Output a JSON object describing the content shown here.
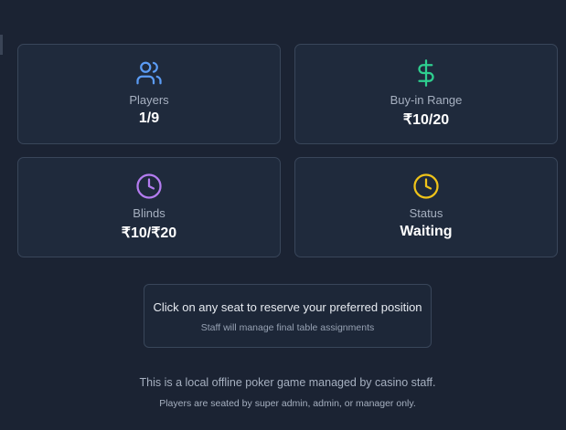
{
  "stats": {
    "players": {
      "label": "Players",
      "value": "1/9",
      "icon": "users-icon",
      "color": "#5b9cf5"
    },
    "buyin": {
      "label": "Buy-in Range",
      "value": "₹10/20",
      "icon": "dollar-icon",
      "color": "#2ecf8f"
    },
    "blinds": {
      "label": "Blinds",
      "value": "₹10/₹20",
      "icon": "clock-icon",
      "color": "#b47cf0"
    },
    "status": {
      "label": "Status",
      "value": "Waiting",
      "icon": "clock-icon",
      "color": "#f0c419"
    }
  },
  "seat_info": {
    "main": "Click on any seat to reserve your preferred position",
    "sub": "Staff will manage final table assignments"
  },
  "footer": {
    "line1": "This is a local offline poker game managed by casino staff.",
    "line2": "Players are seated by super admin, admin, or manager only."
  }
}
